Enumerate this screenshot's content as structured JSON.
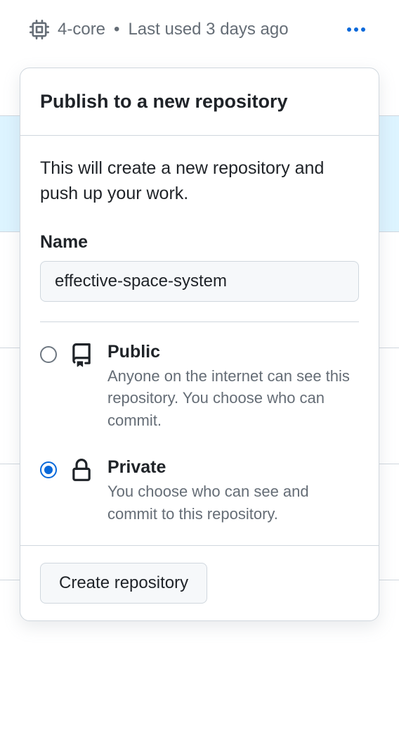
{
  "header": {
    "cores": "4-core",
    "last_used": "Last used 3 days ago"
  },
  "dialog": {
    "title": "Publish to a new repository",
    "description": "This will create a new repository and push up your work.",
    "name_label": "Name",
    "name_value": "effective-space-system",
    "visibility": {
      "public": {
        "title": "Public",
        "description": "Anyone on the internet can see this repository. You choose who can commit.",
        "selected": false
      },
      "private": {
        "title": "Private",
        "description": "You choose who can see and commit to this repository.",
        "selected": true
      }
    },
    "submit_label": "Create repository"
  }
}
